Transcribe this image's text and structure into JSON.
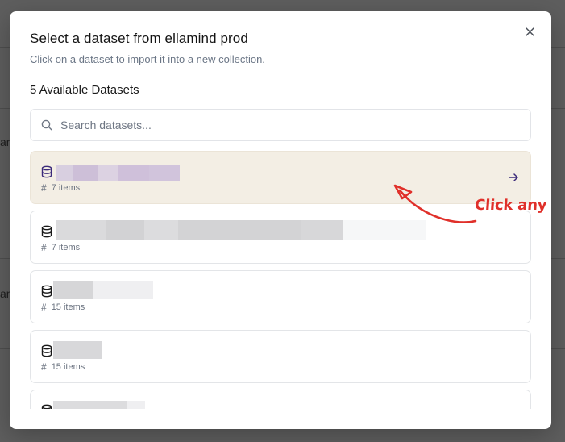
{
  "dialog": {
    "title": "Select a dataset from ellamind prod",
    "subtitle": "Click on a dataset to import it into a new collection.",
    "count_heading": "5 Available Datasets"
  },
  "search": {
    "placeholder": "Search datasets..."
  },
  "datasets": [
    {
      "meta": "7 items",
      "selected": true
    },
    {
      "meta": "7 items",
      "selected": false
    },
    {
      "meta": "15 items",
      "selected": false
    },
    {
      "meta": "15 items",
      "selected": false
    },
    {
      "meta": "",
      "selected": false
    }
  ],
  "annotation": {
    "text": "Click any"
  },
  "colors": {
    "accent": "#3b2a7a",
    "selected_bg": "#f3eee4",
    "annotation": "#e0302a"
  },
  "icons": {
    "close": "close-icon",
    "search": "search-icon",
    "dataset": "database-icon",
    "meta": "hash-icon",
    "open": "arrow-right-icon"
  }
}
